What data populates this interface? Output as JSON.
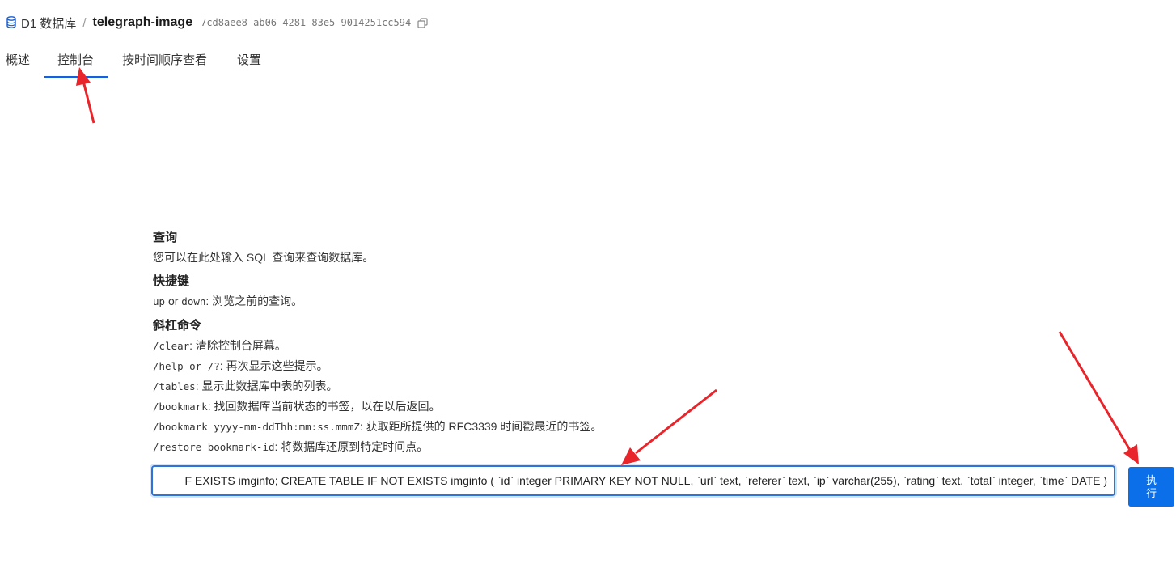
{
  "breadcrumb": {
    "root_label": "D1 数据库",
    "separator": "/",
    "database_name": "telegraph-image",
    "database_id": "7cd8aee8-ab06-4281-83e5-9014251cc594"
  },
  "tabs": [
    {
      "label": "概述",
      "active": false
    },
    {
      "label": "控制台",
      "active": true
    },
    {
      "label": "按时间顺序查看",
      "active": false
    },
    {
      "label": "设置",
      "active": false
    }
  ],
  "help": {
    "query_title": "查询",
    "query_desc": "您可以在此处输入 SQL 查询来查询数据库。",
    "shortcuts_title": "快捷键",
    "shortcut_up": "up",
    "shortcut_or": " or ",
    "shortcut_down": "down",
    "shortcut_desc": ": 浏览之前的查询。",
    "slash_title": "斜杠命令",
    "commands": [
      {
        "cmd": "/clear",
        "desc": ": 清除控制台屏幕。"
      },
      {
        "cmd": "/help or /?",
        "desc": ": 再次显示这些提示。"
      },
      {
        "cmd": "/tables",
        "desc": ": 显示此数据库中表的列表。"
      },
      {
        "cmd": "/bookmark",
        "desc": ": 找回数据库当前状态的书签，以在以后返回。"
      },
      {
        "cmd": "/bookmark yyyy-mm-ddThh:mm:ss.mmmZ",
        "desc": ": 获取距所提供的 RFC3339 时间戳最近的书签。"
      },
      {
        "cmd": "/restore bookmark-id",
        "desc": ": 将数据库还原到特定时间点。"
      }
    ]
  },
  "query": {
    "value": "F EXISTS imginfo; CREATE TABLE IF NOT EXISTS imginfo ( `id` integer PRIMARY KEY NOT NULL, `url` text, `referer` text, `ip` varchar(255), `rating` text, `total` integer, `time` DATE )"
  },
  "execute_button": {
    "label": "执行"
  },
  "colors": {
    "accent": "#0a6fe8",
    "annotation": "#e8252b"
  }
}
